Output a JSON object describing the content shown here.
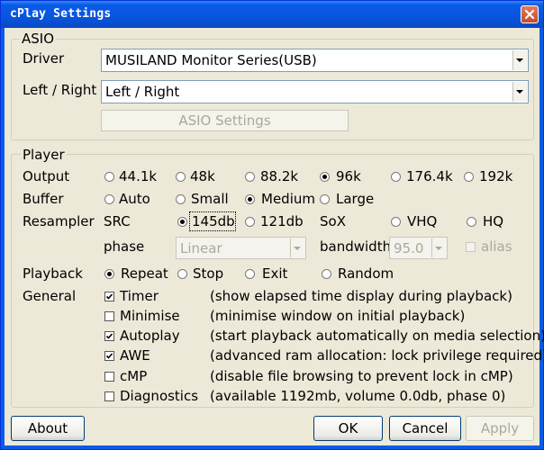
{
  "window": {
    "title": "cPlay Settings"
  },
  "asio": {
    "legend": "ASIO",
    "driver_label": "Driver",
    "driver_value": "MUSILAND Monitor Series(USB)",
    "channels_label": "Left / Right",
    "channels_value": "Left / Right",
    "settings_button": "ASIO Settings"
  },
  "player": {
    "legend": "Player",
    "output": {
      "label": "Output",
      "options": [
        "44.1k",
        "48k",
        "88.2k",
        "96k",
        "176.4k",
        "192k"
      ],
      "selected": "96k"
    },
    "buffer": {
      "label": "Buffer",
      "options": [
        "Auto",
        "Small",
        "Medium",
        "Large"
      ],
      "selected": "Medium"
    },
    "resampler": {
      "label": "Resampler",
      "src_label": "SRC",
      "src_options": [
        "145db",
        "121db"
      ],
      "src_selected": "145db",
      "sox_label": "SoX",
      "sox_options": [
        "VHQ",
        "HQ"
      ],
      "phase_label": "phase",
      "phase_value": "Linear",
      "bandwidth_label": "bandwidth",
      "bandwidth_value": "95.0",
      "alias_label": "alias"
    },
    "playback": {
      "label": "Playback",
      "options": [
        "Repeat",
        "Stop",
        "Exit",
        "Random"
      ],
      "selected": "Repeat"
    },
    "general": {
      "label": "General",
      "items": [
        {
          "label": "Timer",
          "checked": true,
          "desc": "(show elapsed time display during playback)"
        },
        {
          "label": "Minimise",
          "checked": false,
          "desc": "(minimise window on initial playback)"
        },
        {
          "label": "Autoplay",
          "checked": true,
          "desc": "(start playback automatically on media selection)"
        },
        {
          "label": "AWE",
          "checked": true,
          "desc": "(advanced ram allocation: lock privilege required)"
        },
        {
          "label": "cMP",
          "checked": false,
          "desc": "(disable file browsing to prevent lock in cMP)"
        },
        {
          "label": "Diagnostics",
          "checked": false,
          "desc": "(available 1192mb, volume  0.0db, phase 0)"
        }
      ]
    }
  },
  "footer": {
    "about": "About",
    "ok": "OK",
    "cancel": "Cancel",
    "apply": "Apply"
  }
}
